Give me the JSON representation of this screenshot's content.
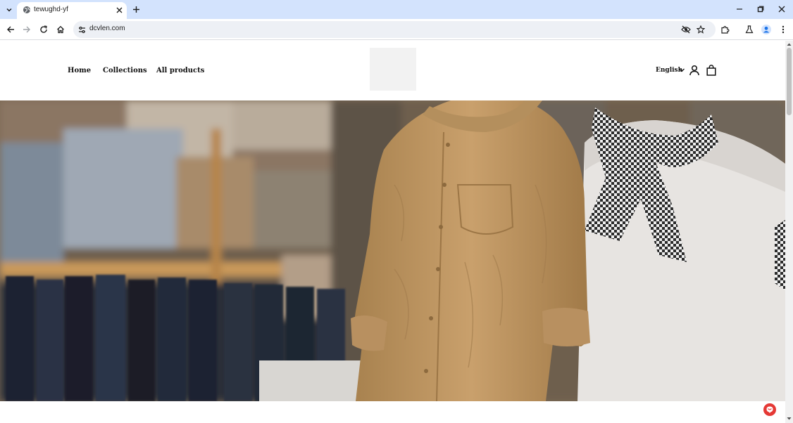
{
  "browser": {
    "tab_title": "tewughd-yf",
    "url": "dcvlen.com"
  },
  "nav": {
    "home": "Home",
    "collections": "Collections",
    "all_products": "All products"
  },
  "header": {
    "language": "English"
  },
  "icons": {
    "tab_list": "chevron-down-icon",
    "favicon": "globe-icon",
    "close_tab": "close-icon",
    "new_tab": "plus-icon",
    "back": "back-arrow-icon",
    "forward": "forward-arrow-icon",
    "reload": "reload-icon",
    "home": "home-icon",
    "site_info": "tune-icon",
    "eye_off": "eye-off-icon",
    "bookmark": "star-icon",
    "extensions": "puzzle-icon",
    "labs": "flask-icon",
    "profile": "avatar-icon",
    "menu": "kebab-menu-icon",
    "account": "user-icon",
    "cart": "shopping-bag-icon",
    "chat": "chat-icon"
  },
  "colors": {
    "tabstrip": "#d3e3fd",
    "omnibox": "#edf0f5",
    "chat_button": "#e53935",
    "profile": "#1a73e8"
  }
}
